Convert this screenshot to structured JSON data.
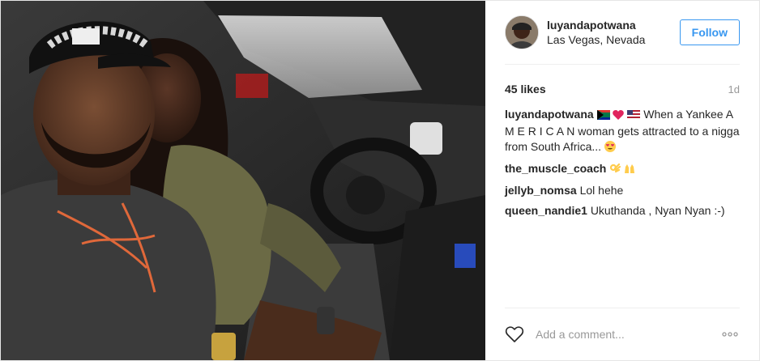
{
  "post": {
    "username": "luyandapotwana",
    "location": "Las Vegas, Nevada",
    "follow_label": "Follow",
    "likes": "45 likes",
    "time": "1d"
  },
  "caption": {
    "author": "luyandapotwana",
    "text": "When a Yankee A M E R I C A N woman gets attracted to a nigga from South Africa..."
  },
  "comments": [
    {
      "author": "the_muscle_coach",
      "text": ""
    },
    {
      "author": "jellyb_nomsa",
      "text": "Lol hehe"
    },
    {
      "author": "queen_nandie1",
      "text": "Ukuthanda , Nyan Nyan :-)"
    }
  ],
  "footer": {
    "comment_placeholder": "Add a comment..."
  },
  "icons": {
    "like": "heart-outline-icon",
    "more": "more-options-icon"
  },
  "colors": {
    "accent": "#3897f0",
    "text": "#262626",
    "muted": "#999999",
    "divider": "#efefef"
  }
}
